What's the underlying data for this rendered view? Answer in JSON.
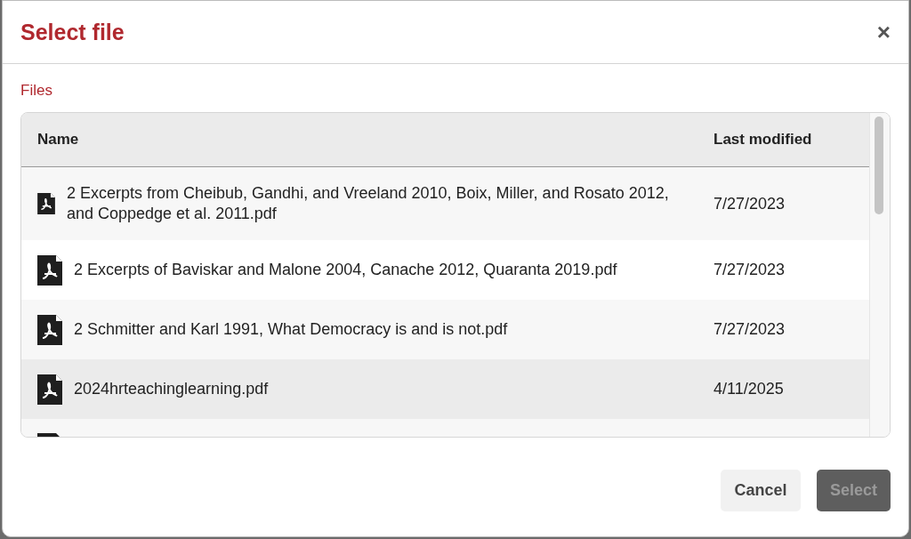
{
  "dialog": {
    "title": "Select file",
    "close": "×"
  },
  "section_label": "Files",
  "table": {
    "columns": [
      "Name",
      "Last modified"
    ],
    "rows": [
      {
        "name": "2 Excerpts from Cheibub, Gandhi, and Vreeland 2010, Boix, Miller, and Rosato 2012, and Coppedge et al. 2011.pdf",
        "modified": "7/27/2023",
        "selected": false
      },
      {
        "name": "2 Excerpts of Baviskar and Malone 2004, Canache 2012, Quaranta 2019.pdf",
        "modified": "7/27/2023",
        "selected": false
      },
      {
        "name": "2 Schmitter and Karl 1991, What Democracy is and is not.pdf",
        "modified": "7/27/2023",
        "selected": false
      },
      {
        "name": "2024hrteachinglearning.pdf",
        "modified": "4/11/2025",
        "selected": true
      }
    ]
  },
  "buttons": [
    {
      "label": "Cancel",
      "kind": "secondary",
      "disabled": false
    },
    {
      "label": "Select",
      "kind": "primary",
      "disabled": true
    }
  ]
}
